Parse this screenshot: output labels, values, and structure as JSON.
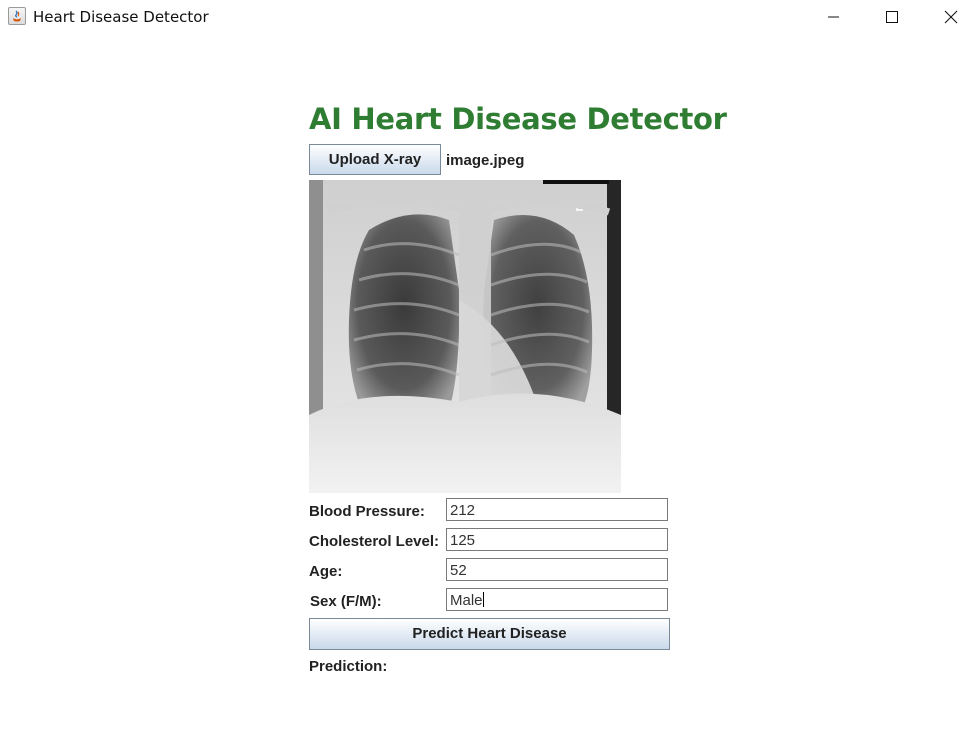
{
  "window": {
    "title": "Heart Disease Detector"
  },
  "main": {
    "heading": "AI Heart Disease Detector",
    "upload_button_label": "Upload X-ray",
    "file_name": "image.jpeg",
    "xray_image": "chest-xray-image"
  },
  "form": {
    "blood_pressure": {
      "label": "Blood Pressure:",
      "value": "212"
    },
    "cholesterol": {
      "label": "Cholesterol Level:",
      "value": "125"
    },
    "age": {
      "label": "Age:",
      "value": "52"
    },
    "sex": {
      "label": "Sex (F/M):",
      "value": "Male"
    }
  },
  "predict_button_label": "Predict Heart Disease",
  "prediction_label": "Prediction:",
  "colors": {
    "heading": "#2e7d32"
  }
}
